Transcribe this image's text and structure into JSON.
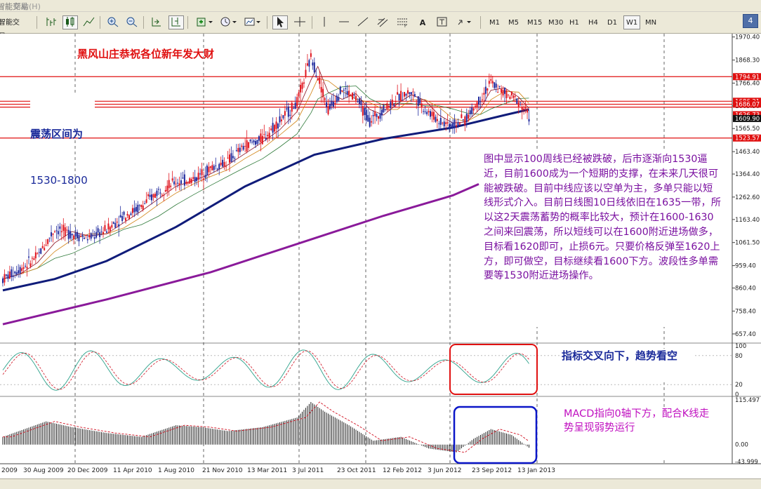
{
  "menu": {
    "help": "帮助",
    "help_key": "(H)",
    "smart_trade": "智能交易"
  },
  "toolbar": {
    "timeframes": [
      "M1",
      "M5",
      "M15",
      "M30",
      "H1",
      "H4",
      "D1",
      "W1",
      "MN"
    ],
    "active_timeframe": "W1",
    "text_tool": "A",
    "badge": "4"
  },
  "annotations": {
    "greeting": "黑风山庄恭祝各位新年发大财",
    "range_title": "震荡区间为",
    "range_value": "1530-1800",
    "analysis": "图中显示100周线已经被跌破，后市逐渐向1530逼近，目前1600成为一个短期的支撑，在未来几天很可能被跌破。目前中线应该以空单为主，多单只能以短线形式介入。目前日线图10日线依旧在1635一带，所以这2天震荡蓄势的概率比较大，预计在1600-1630之间来回震荡，所以短线可以在1600附近进场做多，目标看1620即可，止损6元。只要价格反弹至1620上方，即可做空，目标继续看1600下方。波段性多单需要等1530附近进场操作。",
    "stoch_note": "指标交叉向下，趋势看空",
    "macd_note": "MACD指向0轴下方，配合K线走势呈现弱势运行"
  },
  "colors": {
    "candle_up": "#e0141e",
    "candle_down": "#202a9e",
    "ma_fast": "#8a1020",
    "ma_orange": "#d08010",
    "ma_green": "#2f7a3a",
    "ma_100": "#101c7a",
    "ma_200": "#8a1a9a",
    "level_line": "#e01010",
    "annotation_red": "#e01010",
    "annotation_purple": "#7a10a0",
    "annotation_blue": "#1a2a9a",
    "highlight_box_red": "#e01010",
    "highlight_box_blue": "#0a16c8"
  },
  "chart_data": {
    "type": "candlestick",
    "timeframe": "W1",
    "price_axis": {
      "range": [
        620,
        1985
      ],
      "ticks": [
        "1970.40",
        "1868.30",
        "1766.40",
        "1665.50",
        "1565.50",
        "1463.40",
        "1364.40",
        "1262.60",
        "1163.40",
        "1061.50",
        "959.40",
        "860.40",
        "758.40",
        "657.40"
      ],
      "level_labels": [
        "1794.91",
        "1686.21",
        "1686.07",
        "1626.73",
        "1609.90",
        "1523.57"
      ]
    },
    "horizontal_levels": [
      1794.91,
      1686.21,
      1673.0,
      1660.0,
      1523.57
    ],
    "time_axis": [
      "2009",
      "30 Aug 2009",
      "20 Dec 2009",
      "11 Apr 2010",
      "1 Aug 2010",
      "21 Nov 2010",
      "13 Mar 2011",
      "3 Jul 2011",
      "23 Oct 2011",
      "12 Feb 2012",
      "3 Jun 2012",
      "23 Sep 2012",
      "13 Jan 2013"
    ],
    "close_series": [
      {
        "w": 0,
        "close": 900
      },
      {
        "w": 10,
        "close": 945
      },
      {
        "w": 20,
        "close": 1000
      },
      {
        "w": 30,
        "close": 1120
      },
      {
        "w": 40,
        "close": 1100
      },
      {
        "w": 50,
        "close": 1080
      },
      {
        "w": 60,
        "close": 1120
      },
      {
        "w": 70,
        "close": 1180
      },
      {
        "w": 80,
        "close": 1220
      },
      {
        "w": 90,
        "close": 1290
      },
      {
        "w": 100,
        "close": 1330
      },
      {
        "w": 110,
        "close": 1340
      },
      {
        "w": 120,
        "close": 1390
      },
      {
        "w": 130,
        "close": 1420
      },
      {
        "w": 140,
        "close": 1490
      },
      {
        "w": 150,
        "close": 1520
      },
      {
        "w": 160,
        "close": 1600
      },
      {
        "w": 170,
        "close": 1680
      },
      {
        "w": 178,
        "close": 1880
      },
      {
        "w": 182,
        "close": 1800
      },
      {
        "w": 188,
        "close": 1650
      },
      {
        "w": 196,
        "close": 1740
      },
      {
        "w": 204,
        "close": 1700
      },
      {
        "w": 212,
        "close": 1600
      },
      {
        "w": 220,
        "close": 1650
      },
      {
        "w": 228,
        "close": 1700
      },
      {
        "w": 236,
        "close": 1730
      },
      {
        "w": 244,
        "close": 1650
      },
      {
        "w": 252,
        "close": 1600
      },
      {
        "w": 260,
        "close": 1580
      },
      {
        "w": 268,
        "close": 1610
      },
      {
        "w": 276,
        "close": 1700
      },
      {
        "w": 282,
        "close": 1770
      },
      {
        "w": 290,
        "close": 1720
      },
      {
        "w": 298,
        "close": 1690
      },
      {
        "w": 304,
        "close": 1620
      }
    ],
    "ma100": [
      {
        "w": 0,
        "v": 850
      },
      {
        "w": 30,
        "v": 900
      },
      {
        "w": 60,
        "v": 980
      },
      {
        "w": 100,
        "v": 1130
      },
      {
        "w": 140,
        "v": 1310
      },
      {
        "w": 180,
        "v": 1450
      },
      {
        "w": 220,
        "v": 1520
      },
      {
        "w": 260,
        "v": 1570
      },
      {
        "w": 290,
        "v": 1625
      },
      {
        "w": 304,
        "v": 1650
      }
    ],
    "ma200": [
      {
        "w": 0,
        "v": 700
      },
      {
        "w": 60,
        "v": 810
      },
      {
        "w": 120,
        "v": 930
      },
      {
        "w": 180,
        "v": 1080
      },
      {
        "w": 220,
        "v": 1180
      },
      {
        "w": 260,
        "v": 1270
      },
      {
        "w": 275,
        "v": 1320
      }
    ],
    "stochastic": {
      "levels": [
        100,
        80,
        20,
        0
      ],
      "tick_labels": [
        "100",
        "80",
        "20",
        "0"
      ]
    },
    "macd": {
      "range": [
        -43.999,
        115.497
      ],
      "tick_labels": [
        "115.497",
        "0.00",
        "-43.999"
      ],
      "histogram": [
        {
          "w": 0,
          "v": 20
        },
        {
          "w": 25,
          "v": 60
        },
        {
          "w": 40,
          "v": 45
        },
        {
          "w": 60,
          "v": 30
        },
        {
          "w": 80,
          "v": 20
        },
        {
          "w": 100,
          "v": 50
        },
        {
          "w": 115,
          "v": 45
        },
        {
          "w": 130,
          "v": 35
        },
        {
          "w": 150,
          "v": 45
        },
        {
          "w": 170,
          "v": 70
        },
        {
          "w": 178,
          "v": 110
        },
        {
          "w": 186,
          "v": 85
        },
        {
          "w": 200,
          "v": 50
        },
        {
          "w": 214,
          "v": 10
        },
        {
          "w": 230,
          "v": 20
        },
        {
          "w": 246,
          "v": -10
        },
        {
          "w": 262,
          "v": -20
        },
        {
          "w": 272,
          "v": 15
        },
        {
          "w": 282,
          "v": 40
        },
        {
          "w": 294,
          "v": 25
        },
        {
          "w": 304,
          "v": -8
        }
      ]
    }
  }
}
